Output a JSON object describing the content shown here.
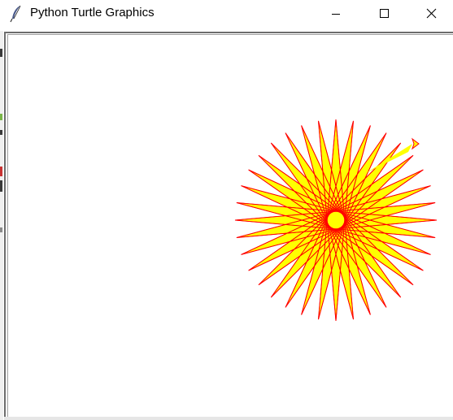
{
  "window": {
    "title": "Python Turtle Graphics",
    "icon": "feather-icon",
    "controls": [
      "minimize-icon",
      "maximize-icon",
      "close-icon"
    ]
  },
  "drawing": {
    "shape": "star",
    "points": 36,
    "fill_color": "#ffff00",
    "pen_color": "#ff0000",
    "center_dot_color": "#ffff00",
    "turtle_cursor": "arrow"
  }
}
